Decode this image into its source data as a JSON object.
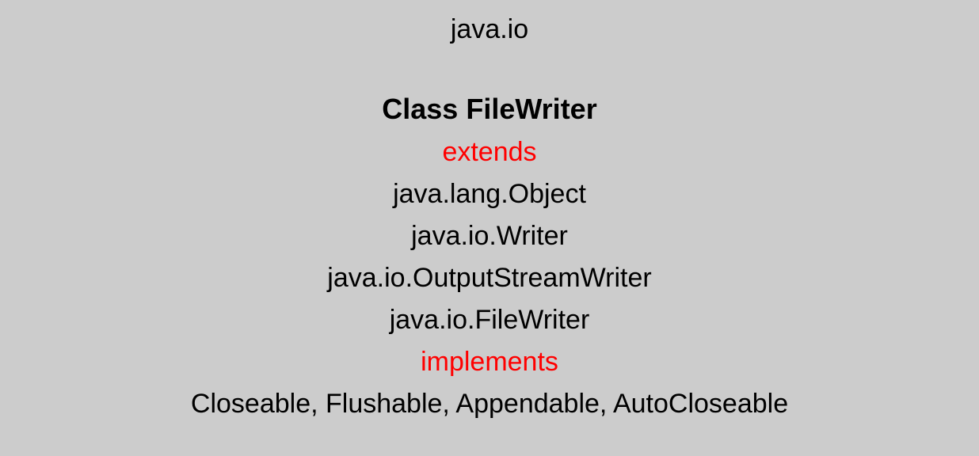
{
  "package": "java.io",
  "classTitle": "Class FileWriter",
  "extendsKeyword": "extends",
  "hierarchy": {
    "level0": "java.lang.Object",
    "level1": "java.io.Writer",
    "level2": "java.io.OutputStreamWriter",
    "level3": "java.io.FileWriter"
  },
  "implementsKeyword": "implements",
  "interfaces": "Closeable, Flushable, Appendable, AutoCloseable"
}
